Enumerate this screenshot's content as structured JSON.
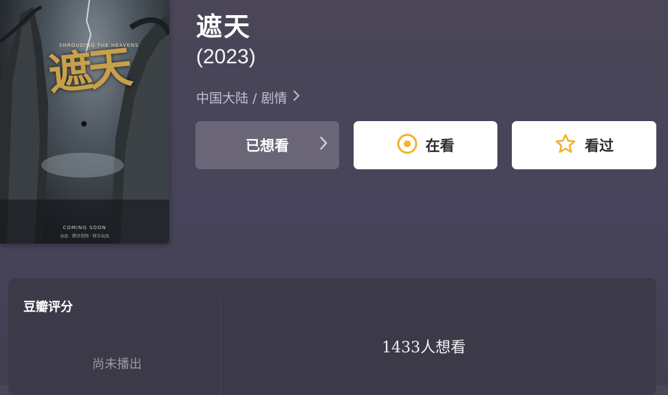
{
  "movie": {
    "title": "遮天",
    "year": "(2023)",
    "genre_line": "中国大陆 / 剧情"
  },
  "poster": {
    "title_art": "遮天",
    "subtitle": "SHROUDING THE HEAVENS",
    "coming_text": "COMING SOON",
    "logos_text": "出品 · 腾讯视频 · 联合出品"
  },
  "actions": {
    "wanted_label": "已想看",
    "watching_label": "在看",
    "watched_label": "看过"
  },
  "rating": {
    "label": "豆瓣评分",
    "status": "尚未播出",
    "want_count": "1433人想看"
  },
  "icons": {
    "genre_chevron": "chevron-right-icon",
    "wanted_chevron": "chevron-right-icon",
    "watching": "target-circle-icon",
    "watched": "star-outline-icon"
  },
  "colors": {
    "accent_gold": "#f0b429",
    "background": "#48445a",
    "panel": "#3c3948",
    "wanted_button": "#6a6677"
  }
}
